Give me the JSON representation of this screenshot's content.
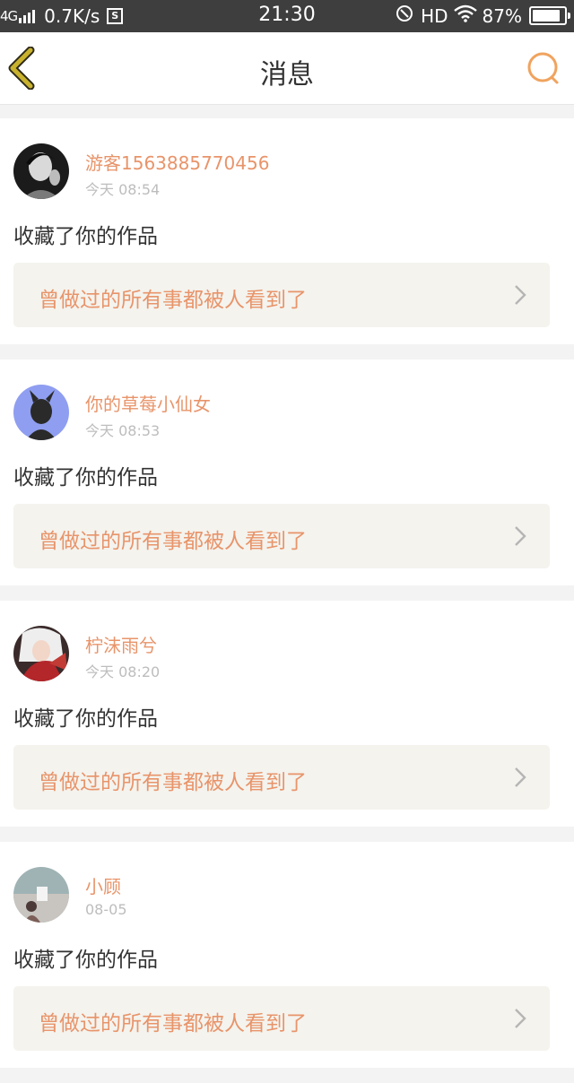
{
  "status_bar": {
    "network": "4G",
    "speed": "0.7K/s",
    "s_badge": "S",
    "time": "21:30",
    "hd": "HD",
    "battery": "87%",
    "battery_level": 0.87
  },
  "header": {
    "title": "消息"
  },
  "messages": [
    {
      "username": "游客1563885770456",
      "time": "今天 08:54",
      "action": "收藏了你的作品",
      "work_title": "曾做过的所有事都被人看到了"
    },
    {
      "username": "你的草莓小仙女",
      "time": "今天 08:53",
      "action": "收藏了你的作品",
      "work_title": "曾做过的所有事都被人看到了"
    },
    {
      "username": "柠沫雨兮",
      "time": "今天 08:20",
      "action": "收藏了你的作品",
      "work_title": "曾做过的所有事都被人看到了"
    },
    {
      "username": "小顾",
      "time": "08-05",
      "action": "收藏了你的作品",
      "work_title": "曾做过的所有事都被人看到了"
    }
  ],
  "colors": {
    "accent": "#e8946a",
    "back_icon": "#c9b22e",
    "search_icon": "#f0a35e"
  }
}
